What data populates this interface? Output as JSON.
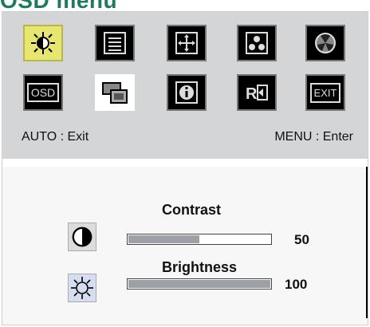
{
  "header": {
    "title": "OSD menu"
  },
  "menu_rows": [
    [
      {
        "name": "brightness-menu-icon",
        "selected": true
      },
      {
        "name": "image-menu-icon",
        "selected": false
      },
      {
        "name": "position-menu-icon",
        "selected": false
      },
      {
        "name": "color-menu-icon",
        "selected": false
      },
      {
        "name": "settings-menu-icon",
        "selected": false
      }
    ],
    [
      {
        "name": "osd-menu-icon",
        "selected": false
      },
      {
        "name": "input-menu-icon",
        "selected": false
      },
      {
        "name": "info-menu-icon",
        "selected": false
      },
      {
        "name": "reset-menu-icon",
        "selected": false
      },
      {
        "name": "exit-menu-icon",
        "selected": false
      }
    ]
  ],
  "icons_text": {
    "osd": "OSD",
    "exit": "EXIT"
  },
  "hints": {
    "left": "AUTO : Exit",
    "right": "MENU : Enter"
  },
  "settings": [
    {
      "label": "Contrast",
      "value": "50",
      "level": 0.5
    },
    {
      "label": "Brightness",
      "value": "100",
      "level": 1.0
    }
  ],
  "colors": {
    "selected": "#e7e76f",
    "fill": "#9da0a6",
    "panel": "#d4d5d7"
  }
}
